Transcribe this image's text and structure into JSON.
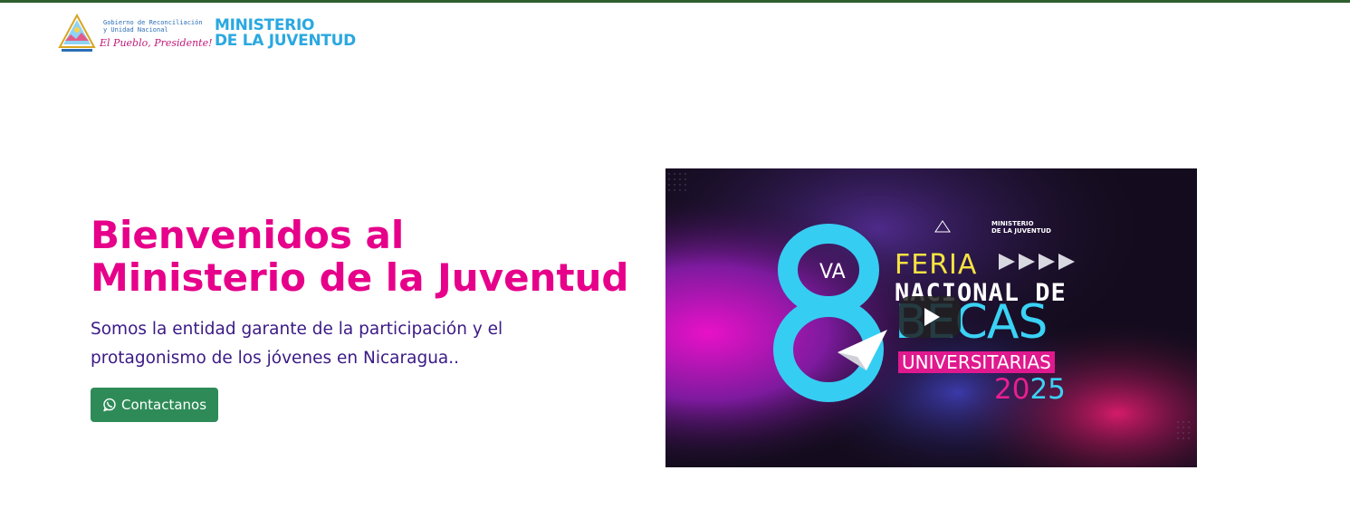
{
  "header": {
    "government_line1": "Gobierno de Reconciliación",
    "government_line2": "y Unidad Nacional",
    "slogan": "El Pueblo, Presidente!",
    "ministry_line1": "MINISTERIO",
    "ministry_line2": "DE LA JUVENTUD",
    "brand_color": "#2aa8e0"
  },
  "hero": {
    "title_line1": "Bienvenidos al",
    "title_line2": "Ministerio de la Juventud",
    "description": "Somos la entidad garante de la participación y el protagonismo de los jóvenes en Nicaragua..",
    "contact_button": "Contactanos",
    "contact_icon": "whatsapp-icon",
    "title_color": "#e6008a",
    "description_color": "#3b1a86",
    "button_color": "#2e8b57"
  },
  "video": {
    "logo_ministry_line1": "MINISTERIO",
    "logo_ministry_line2": "DE LA JUVENTUD",
    "number": "8",
    "ordinal": "VA",
    "line1": "FERIA",
    "line2": "NACIONAL DE",
    "line3": "BECAS",
    "line4": "UNIVERSITARIAS",
    "year_part1": "20",
    "year_part2": "25",
    "play_icon": "play-icon"
  }
}
